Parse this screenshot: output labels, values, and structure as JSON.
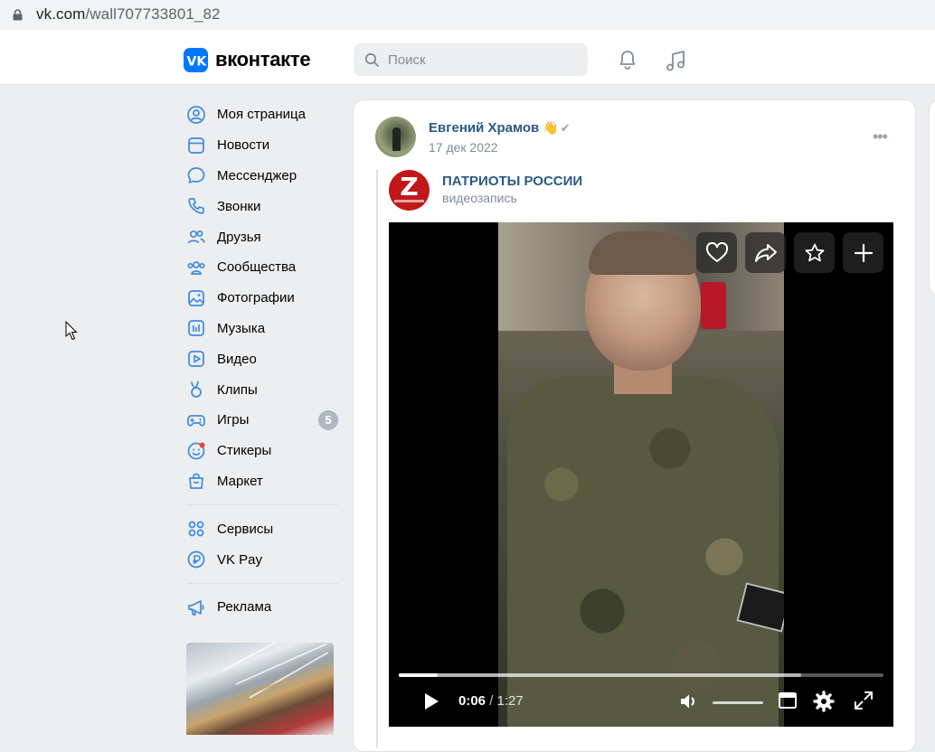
{
  "browser": {
    "url_host": "vk.com",
    "url_path": "/wall707733801_82"
  },
  "header": {
    "logo_text": "вконтакте",
    "search_placeholder": "Поиск"
  },
  "sidebar": {
    "items": [
      {
        "label": "Моя страница",
        "icon": "user-circle-icon"
      },
      {
        "label": "Новости",
        "icon": "news-icon"
      },
      {
        "label": "Мессенджер",
        "icon": "message-icon"
      },
      {
        "label": "Звонки",
        "icon": "phone-icon"
      },
      {
        "label": "Друзья",
        "icon": "friends-icon"
      },
      {
        "label": "Сообщества",
        "icon": "communities-icon"
      },
      {
        "label": "Фотографии",
        "icon": "photo-icon"
      },
      {
        "label": "Музыка",
        "icon": "music-icon"
      },
      {
        "label": "Видео",
        "icon": "video-icon"
      },
      {
        "label": "Клипы",
        "icon": "clips-icon"
      },
      {
        "label": "Игры",
        "icon": "games-icon",
        "badge": "5"
      },
      {
        "label": "Стикеры",
        "icon": "stickers-icon"
      },
      {
        "label": "Маркет",
        "icon": "market-icon"
      }
    ],
    "items2": [
      {
        "label": "Сервисы",
        "icon": "services-icon"
      },
      {
        "label": "VK Pay",
        "icon": "vkpay-icon"
      }
    ],
    "items3": [
      {
        "label": "Реклама",
        "icon": "ads-icon"
      }
    ]
  },
  "post": {
    "author": "Евгений Храмов",
    "author_emoji": "👋",
    "verified": "✔",
    "date": "17 дек 2022",
    "more": "•••",
    "source_name": "ПАТРИОТЫ РОССИИ",
    "source_type": "видеозапись",
    "source_logo_letter": "Z"
  },
  "video": {
    "current_time": "0:06",
    "time_sep": "/",
    "duration": "1:27",
    "progress_fraction": 0.08,
    "buffer_fraction": 0.83
  },
  "colors": {
    "vk_blue": "#0077ff",
    "link": "#2a5885",
    "secondary_text": "#818c99",
    "badge": "#aeb7c2"
  }
}
